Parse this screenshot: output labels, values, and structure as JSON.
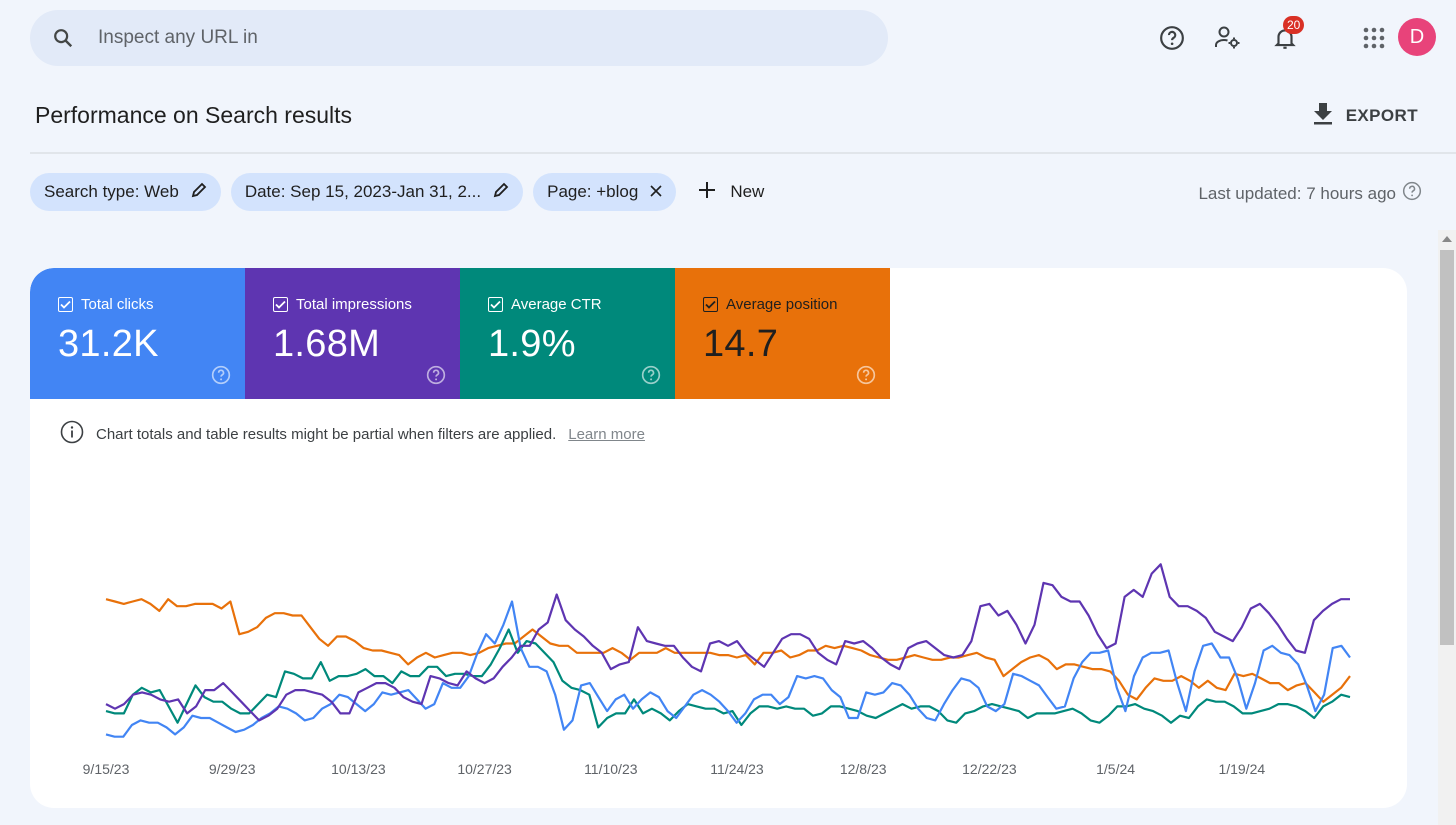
{
  "search": {
    "placeholder": "Inspect any URL in",
    "icon": "search-icon"
  },
  "topbar": {
    "icons": [
      "help-icon",
      "manage-users-icon",
      "notifications-icon",
      "apps-grid-icon"
    ],
    "notification_count": "20",
    "avatar_letter": "D",
    "avatar_color": "#e8437a"
  },
  "page": {
    "title": "Performance on Search results",
    "export_label": "EXPORT"
  },
  "filters": {
    "chips": [
      {
        "label": "Search type: Web",
        "action_icon": "edit-icon"
      },
      {
        "label": "Date: Sep 15, 2023-Jan 31, 2...",
        "action_icon": "edit-icon"
      },
      {
        "label": "Page: +blog",
        "action_icon": "close-icon"
      }
    ],
    "new_label": "New",
    "last_updated": "Last updated: 7 hours ago"
  },
  "metrics": [
    {
      "label": "Total clicks",
      "value": "31.2K",
      "checked": true,
      "color": "#4285f4"
    },
    {
      "label": "Total impressions",
      "value": "1.68M",
      "checked": true,
      "color": "#5e35b1"
    },
    {
      "label": "Average CTR",
      "value": "1.9%",
      "checked": true,
      "color": "#00897b"
    },
    {
      "label": "Average position",
      "value": "14.7",
      "checked": true,
      "color": "#e8710a"
    }
  ],
  "notice": {
    "text": "Chart totals and table results might be partial when filters are applied.",
    "link": "Learn more"
  },
  "chart_data": {
    "type": "line",
    "title": "",
    "xlabel": "",
    "ylabel": "",
    "y_axis_note": "Each series has its own hidden scale; values are relative (0-100 of chart height)",
    "ylim": [
      0,
      100
    ],
    "x_start": "9/15/23",
    "x_end": "1/31/24",
    "x_ticks": [
      "9/15/23",
      "9/29/23",
      "10/13/23",
      "10/27/23",
      "11/10/23",
      "11/24/23",
      "12/8/23",
      "12/22/23",
      "1/5/24",
      "1/19/24"
    ],
    "grid": false,
    "legend": "none",
    "series": [
      {
        "name": "Total impressions",
        "color": "#5e35b1",
        "values": [
          18,
          16,
          18,
          22,
          23,
          22,
          20,
          19,
          20,
          14,
          17,
          24,
          24,
          27,
          23,
          19,
          15,
          11,
          13,
          16,
          22,
          24,
          24,
          23,
          22,
          19,
          14,
          14,
          23,
          25,
          27,
          27,
          25,
          21,
          19,
          18,
          30,
          29,
          27,
          26,
          32,
          29,
          27,
          29,
          34,
          38,
          43,
          43,
          50,
          53,
          65,
          54,
          50,
          47,
          43,
          40,
          33,
          35,
          36,
          51,
          45,
          44,
          43,
          43,
          38,
          34,
          32,
          44,
          45,
          43,
          45,
          40,
          37,
          34,
          40,
          46,
          48,
          48,
          46,
          40,
          37,
          35,
          45,
          44,
          45,
          42,
          38,
          35,
          33,
          42,
          44,
          45,
          42,
          39,
          38,
          39,
          45,
          60,
          61,
          56,
          58,
          52,
          44,
          52,
          70,
          69,
          64,
          62,
          62,
          56,
          48,
          42,
          44,
          64,
          67,
          64,
          74,
          78,
          64,
          60,
          60,
          58,
          55,
          49,
          47,
          45,
          51,
          59,
          61,
          57,
          52,
          46,
          41,
          40,
          54,
          58,
          61,
          63,
          63
        ]
      },
      {
        "name": "Total clicks",
        "color": "#4285f4",
        "values": [
          5,
          4,
          4,
          9,
          11,
          10,
          10,
          8,
          5,
          8,
          13,
          12,
          12,
          10,
          8,
          6,
          7,
          9,
          12,
          14,
          17,
          16,
          14,
          11,
          12,
          16,
          18,
          22,
          21,
          18,
          15,
          18,
          23,
          22,
          23,
          24,
          20,
          16,
          18,
          27,
          25,
          25,
          30,
          40,
          48,
          44,
          52,
          62,
          42,
          34,
          34,
          32,
          22,
          7,
          11,
          26,
          27,
          21,
          15,
          20,
          22,
          16,
          20,
          23,
          21,
          15,
          12,
          17,
          22,
          24,
          22,
          19,
          15,
          10,
          14,
          20,
          22,
          22,
          18,
          21,
          30,
          29,
          30,
          29,
          24,
          21,
          12,
          12,
          23,
          22,
          23,
          27,
          26,
          22,
          16,
          12,
          11,
          18,
          24,
          29,
          28,
          25,
          17,
          15,
          18,
          31,
          30,
          28,
          26,
          21,
          16,
          17,
          29,
          36,
          40,
          40,
          41,
          25,
          15,
          30,
          38,
          40,
          40,
          41,
          27,
          15,
          32,
          43,
          44,
          38,
          38,
          29,
          16,
          27,
          41,
          43,
          40,
          39,
          35,
          26,
          15,
          22,
          42,
          43,
          38
        ]
      },
      {
        "name": "Average CTR",
        "color": "#00897b",
        "values": [
          15,
          14,
          14,
          22,
          25,
          23,
          24,
          17,
          10,
          18,
          26,
          21,
          19,
          19,
          16,
          14,
          14,
          18,
          22,
          21,
          32,
          31,
          29,
          29,
          36,
          28,
          30,
          30,
          31,
          33,
          30,
          30,
          27,
          32,
          30,
          30,
          34,
          34,
          30,
          31,
          31,
          30,
          30,
          35,
          42,
          50,
          40,
          45,
          44,
          40,
          36,
          28,
          25,
          24,
          22,
          8,
          12,
          14,
          14,
          20,
          14,
          16,
          14,
          11,
          15,
          18,
          17,
          16,
          16,
          14,
          15,
          9,
          14,
          17,
          17,
          16,
          17,
          16,
          16,
          13,
          14,
          17,
          17,
          16,
          15,
          13,
          12,
          14,
          16,
          18,
          16,
          17,
          17,
          15,
          11,
          10,
          14,
          15,
          17,
          18,
          17,
          16,
          15,
          12,
          14,
          14,
          14,
          15,
          16,
          14,
          11,
          10,
          13,
          17,
          17,
          18,
          16,
          15,
          13,
          10,
          13,
          12,
          17,
          20,
          19,
          19,
          17,
          14,
          14,
          15,
          16,
          18,
          18,
          17,
          15,
          12,
          17,
          19,
          22,
          21
        ]
      },
      {
        "name": "Average position",
        "color": "#e8710a",
        "values": [
          63,
          62,
          61,
          62,
          63,
          61,
          58,
          63,
          60,
          60,
          61,
          61,
          61,
          59,
          62,
          48,
          49,
          51,
          55,
          57,
          57,
          56,
          56,
          51,
          46,
          43,
          47,
          47,
          45,
          42,
          41,
          41,
          40,
          39,
          35,
          38,
          40,
          38,
          39,
          40,
          40,
          39,
          40,
          42,
          43,
          44,
          44,
          47,
          50,
          47,
          44,
          43,
          43,
          40,
          40,
          40,
          40,
          42,
          40,
          37,
          40,
          40,
          40,
          42,
          40,
          40,
          40,
          40,
          40,
          39,
          39,
          38,
          39,
          35,
          40,
          40,
          41,
          38,
          39,
          41,
          41,
          43,
          42,
          43,
          42,
          41,
          39,
          38,
          37,
          37,
          38,
          39,
          38,
          37,
          37,
          38,
          38,
          39,
          40,
          38,
          37,
          30,
          33,
          36,
          38,
          39,
          37,
          33,
          35,
          35,
          34,
          33,
          33,
          32,
          28,
          22,
          20,
          25,
          29,
          28,
          28,
          30,
          28,
          25,
          28,
          25,
          24,
          31,
          30,
          31,
          29,
          27,
          27,
          24,
          26,
          27,
          23,
          19,
          22,
          25,
          30
        ]
      }
    ]
  }
}
